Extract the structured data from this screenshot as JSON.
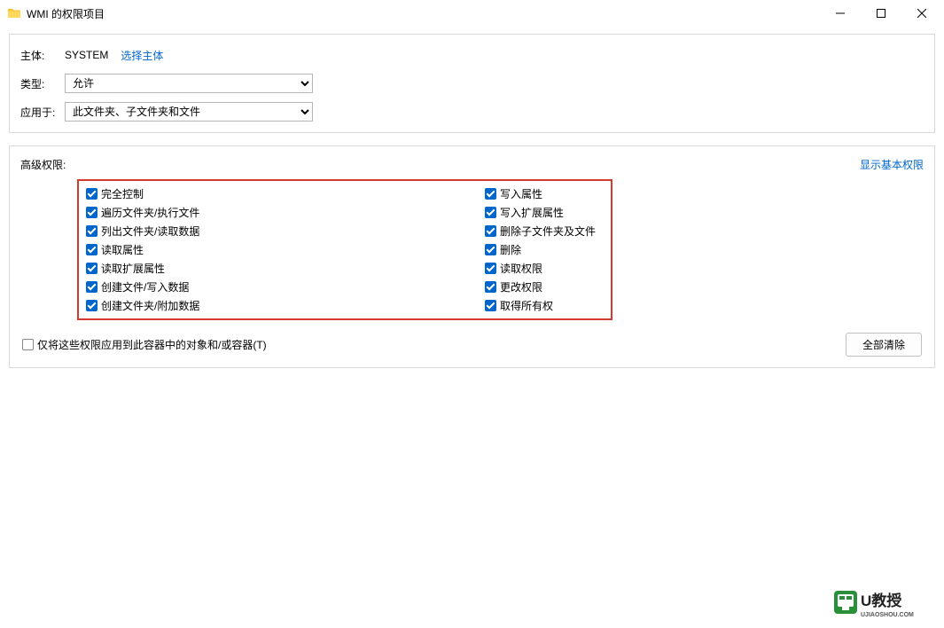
{
  "window": {
    "title": "WMI 的权限项目"
  },
  "top_panel": {
    "principal_label": "主体:",
    "principal_value": "SYSTEM",
    "select_principal_link": "选择主体",
    "type_label": "类型:",
    "type_value": "允许",
    "applies_label": "应用于:",
    "applies_value": "此文件夹、子文件夹和文件"
  },
  "adv_panel": {
    "title": "高级权限:",
    "show_basic": "显示基本权限",
    "clear_all": "全部清除",
    "apply_only_label": "仅将这些权限应用到此容器中的对象和/或容器(T)",
    "apply_only_checked": false,
    "permissions_left": [
      {
        "label": "完全控制",
        "checked": true
      },
      {
        "label": "遍历文件夹/执行文件",
        "checked": true
      },
      {
        "label": "列出文件夹/读取数据",
        "checked": true
      },
      {
        "label": "读取属性",
        "checked": true
      },
      {
        "label": "读取扩展属性",
        "checked": true
      },
      {
        "label": "创建文件/写入数据",
        "checked": true
      },
      {
        "label": "创建文件夹/附加数据",
        "checked": true
      }
    ],
    "permissions_right": [
      {
        "label": "写入属性",
        "checked": true
      },
      {
        "label": "写入扩展属性",
        "checked": true
      },
      {
        "label": "删除子文件夹及文件",
        "checked": true
      },
      {
        "label": "删除",
        "checked": true
      },
      {
        "label": "读取权限",
        "checked": true
      },
      {
        "label": "更改权限",
        "checked": true
      },
      {
        "label": "取得所有权",
        "checked": true
      }
    ]
  },
  "watermark": {
    "brand_text": "U教授",
    "brand_sub": "UJIAOSHOU.COM"
  }
}
